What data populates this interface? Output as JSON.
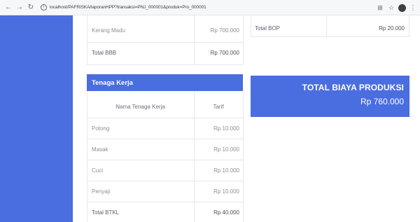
{
  "browser": {
    "url": "localhost/PAFRISKA/laporanHPP?transaksi=PNJ_000001&produk=Pro_000001"
  },
  "bbb_table": {
    "rows": [
      {
        "name": "Kerang Madu",
        "amount": "Rp 700.000"
      }
    ],
    "total_label": "Total BBB",
    "total_value": "Rp 700.000"
  },
  "bop_table": {
    "total_label": "Total BOP",
    "total_value": "Rp 20.000"
  },
  "tenaga_kerja": {
    "title": "Tenaga Kerja",
    "col_name": "Nama Tenaga Kerja",
    "col_tarif": "Tarif",
    "rows": [
      {
        "name": "Potong",
        "tarif": "Rp 10.000"
      },
      {
        "name": "Masak",
        "tarif": "Rp 10.000"
      },
      {
        "name": "Cuci",
        "tarif": "Rp 10.000"
      },
      {
        "name": "Penyaji",
        "tarif": "Rp 10.000"
      }
    ],
    "total_label": "Total BTKL",
    "total_value": "Rp 40.000"
  },
  "total_biaya": {
    "title": "TOTAL BIAYA PRODUKSI",
    "amount": "Rp 760.000"
  },
  "colors": {
    "accent": "#4a6de0",
    "border": "#e6e8eb"
  }
}
